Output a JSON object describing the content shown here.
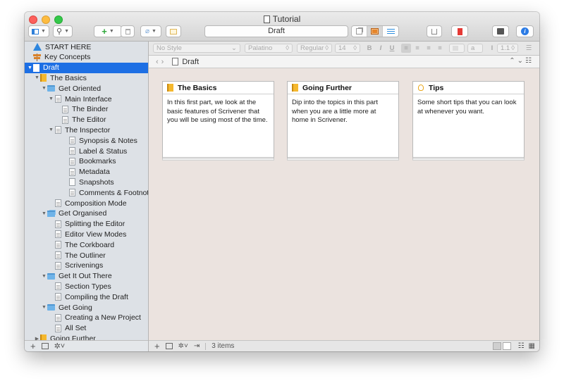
{
  "window": {
    "title": "Tutorial"
  },
  "toolbar": {
    "document_title": "Draft"
  },
  "binder": {
    "items": [
      {
        "label": "START HERE",
        "depth": 0,
        "icon": "warning-icon",
        "disclosure": ""
      },
      {
        "label": "Key Concepts",
        "depth": 0,
        "icon": "signpost-icon",
        "disclosure": ""
      },
      {
        "label": "Draft",
        "depth": 0,
        "icon": "draft-book-icon",
        "disclosure": "▼",
        "selected": true
      },
      {
        "label": "The Basics",
        "depth": 1,
        "icon": "book-icon",
        "disclosure": "▼"
      },
      {
        "label": "Get Oriented",
        "depth": 2,
        "icon": "folder-icon",
        "disclosure": "▼"
      },
      {
        "label": "Main Interface",
        "depth": 3,
        "icon": "document-icon",
        "disclosure": "▼"
      },
      {
        "label": "The Binder",
        "depth": 4,
        "icon": "document-icon",
        "disclosure": ""
      },
      {
        "label": "The Editor",
        "depth": 4,
        "icon": "document-icon",
        "disclosure": ""
      },
      {
        "label": "The Inspector",
        "depth": 3,
        "icon": "document-icon",
        "disclosure": "▼"
      },
      {
        "label": "Synopsis & Notes",
        "depth": 5,
        "icon": "document-icon",
        "disclosure": ""
      },
      {
        "label": "Label & Status",
        "depth": 5,
        "icon": "document-icon",
        "disclosure": ""
      },
      {
        "label": "Bookmarks",
        "depth": 5,
        "icon": "document-icon",
        "disclosure": ""
      },
      {
        "label": "Metadata",
        "depth": 5,
        "icon": "document-icon",
        "disclosure": ""
      },
      {
        "label": "Snapshots",
        "depth": 5,
        "icon": "snapshot-icon",
        "disclosure": ""
      },
      {
        "label": "Comments & Footnotes",
        "depth": 5,
        "icon": "document-icon",
        "disclosure": ""
      },
      {
        "label": "Composition Mode",
        "depth": 3,
        "icon": "document-icon",
        "disclosure": ""
      },
      {
        "label": "Get Organised",
        "depth": 2,
        "icon": "folder-stack-icon",
        "disclosure": "▼"
      },
      {
        "label": "Splitting the Editor",
        "depth": 3,
        "icon": "document-icon",
        "disclosure": ""
      },
      {
        "label": "Editor View Modes",
        "depth": 3,
        "icon": "document-icon",
        "disclosure": ""
      },
      {
        "label": "The Corkboard",
        "depth": 3,
        "icon": "document-icon",
        "disclosure": ""
      },
      {
        "label": "The Outliner",
        "depth": 3,
        "icon": "document-icon",
        "disclosure": ""
      },
      {
        "label": "Scrivenings",
        "depth": 3,
        "icon": "document-icon",
        "disclosure": ""
      },
      {
        "label": "Get It Out There",
        "depth": 2,
        "icon": "folder-icon",
        "disclosure": "▼"
      },
      {
        "label": "Section Types",
        "depth": 3,
        "icon": "document-icon",
        "disclosure": ""
      },
      {
        "label": "Compiling the Draft",
        "depth": 3,
        "icon": "document-icon",
        "disclosure": ""
      },
      {
        "label": "Get Going",
        "depth": 2,
        "icon": "folder-icon",
        "disclosure": "▼"
      },
      {
        "label": "Creating a New Project",
        "depth": 3,
        "icon": "document-icon",
        "disclosure": ""
      },
      {
        "label": "All Set",
        "depth": 3,
        "icon": "document-icon",
        "disclosure": ""
      },
      {
        "label": "Going Further",
        "depth": 1,
        "icon": "book-icon",
        "disclosure": "▶"
      }
    ]
  },
  "format_bar": {
    "style": "No Style",
    "font": "Palatino",
    "weight": "Regular",
    "size": "14",
    "bold": "B",
    "italic": "I",
    "underline": "U",
    "line_spacing": "1.1"
  },
  "path_bar": {
    "title": "Draft"
  },
  "corkboard": {
    "cards": [
      {
        "title": "The Basics",
        "icon": "book-icon",
        "synopsis": "In this first part, we look at the basic features of Scrivener that you will be using most of the time."
      },
      {
        "title": "Going Further",
        "icon": "book-icon",
        "synopsis": "Dip into the topics in this part when you are a little more at home in Scrivener."
      },
      {
        "title": "Tips",
        "icon": "lightbulb-icon",
        "synopsis": "Some short tips that you can look at whenever you want."
      }
    ]
  },
  "footer": {
    "item_count": "3 items"
  },
  "colors": {
    "selection": "#1d6fe4",
    "corkboard": "#ebe3df",
    "sidebar": "#dde1e6"
  }
}
